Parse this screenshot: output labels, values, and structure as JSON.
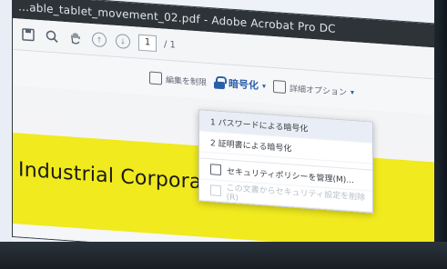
{
  "window": {
    "title": "…able_tablet_movement_02.pdf - Adobe Acrobat Pro DC"
  },
  "toolbar": {
    "page_current": "1",
    "page_total": "/ 1"
  },
  "commandbar": {
    "edit_label": "編集を制限",
    "encrypt_label": "暗号化",
    "caret": "▾",
    "advanced_label": "詳細オプション",
    "advanced_caret": "▾"
  },
  "menu": {
    "items": [
      {
        "label": "1 パスワードによる暗号化",
        "state": "highlight"
      },
      {
        "label": "2 証明書による暗号化",
        "state": "normal"
      },
      {
        "label": "セキュリティポリシーを管理(M)...",
        "state": "normal"
      },
      {
        "label": "この文書からセキュリティ設定を削除(R)",
        "state": "disabled"
      }
    ]
  },
  "document": {
    "company_name": "Industrial Corporation"
  },
  "colors": {
    "titlebar_bg": "#2e3338",
    "accent_blue": "#2a5fa8",
    "banner_yellow": "#f0ea1e"
  }
}
